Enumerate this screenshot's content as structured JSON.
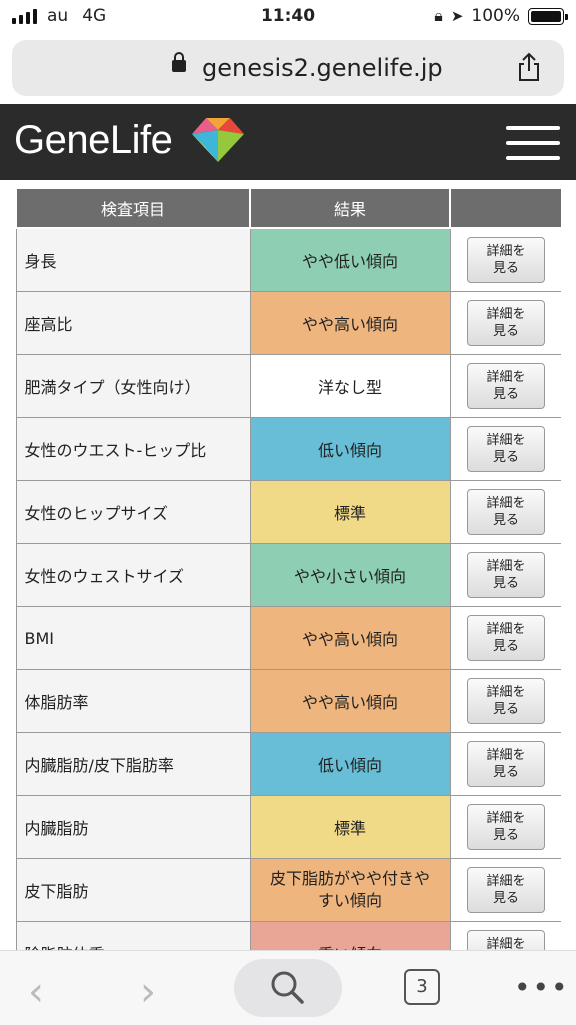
{
  "status": {
    "carrier": "au",
    "network": "4G",
    "time": "11:40",
    "battery": "100%"
  },
  "browser": {
    "url": "genesis2.genelife.jp",
    "tab_count": "3"
  },
  "header": {
    "logo": "GeneLife"
  },
  "table": {
    "columns": [
      "検査項目",
      "結果",
      ""
    ],
    "rows": [
      {
        "item": "身長",
        "result": "やや低い傾向",
        "color": "#8ecfb3",
        "button": "詳細を\n見る"
      },
      {
        "item": "座高比",
        "result": "やや高い傾向",
        "color": "#eeb57e",
        "button": "詳細を\n見る"
      },
      {
        "item": "肥満タイプ（女性向け）",
        "result": "洋なし型",
        "color": "#ffffff",
        "button": "詳細を\n見る"
      },
      {
        "item": "女性のウエスト-ヒップ比",
        "result": "低い傾向",
        "color": "#67bed6",
        "button": "詳細を\n見る"
      },
      {
        "item": "女性のヒップサイズ",
        "result": "標準",
        "color": "#f0da88",
        "button": "詳細を\n見る"
      },
      {
        "item": "女性のウェストサイズ",
        "result": "やや小さい傾向",
        "color": "#8ecfb3",
        "button": "詳細を\n見る"
      },
      {
        "item": "BMI",
        "result": "やや高い傾向",
        "color": "#eeb57e",
        "button": "詳細を\n見る"
      },
      {
        "item": "体脂肪率",
        "result": "やや高い傾向",
        "color": "#eeb57e",
        "button": "詳細を\n見る"
      },
      {
        "item": "内臓脂肪/皮下脂肪率",
        "result": "低い傾向",
        "color": "#67bed6",
        "button": "詳細を\n見る"
      },
      {
        "item": "内臓脂肪",
        "result": "標準",
        "color": "#f0da88",
        "button": "詳細を\n見る"
      },
      {
        "item": "皮下脂肪",
        "result": "皮下脂肪がやや付きやすい傾向",
        "color": "#eeb57e",
        "button": "詳細を\n見る"
      },
      {
        "item": "除脂肪体重",
        "result": "重い傾向",
        "color": "#e9a595",
        "button": "詳細を\n見る"
      }
    ]
  }
}
